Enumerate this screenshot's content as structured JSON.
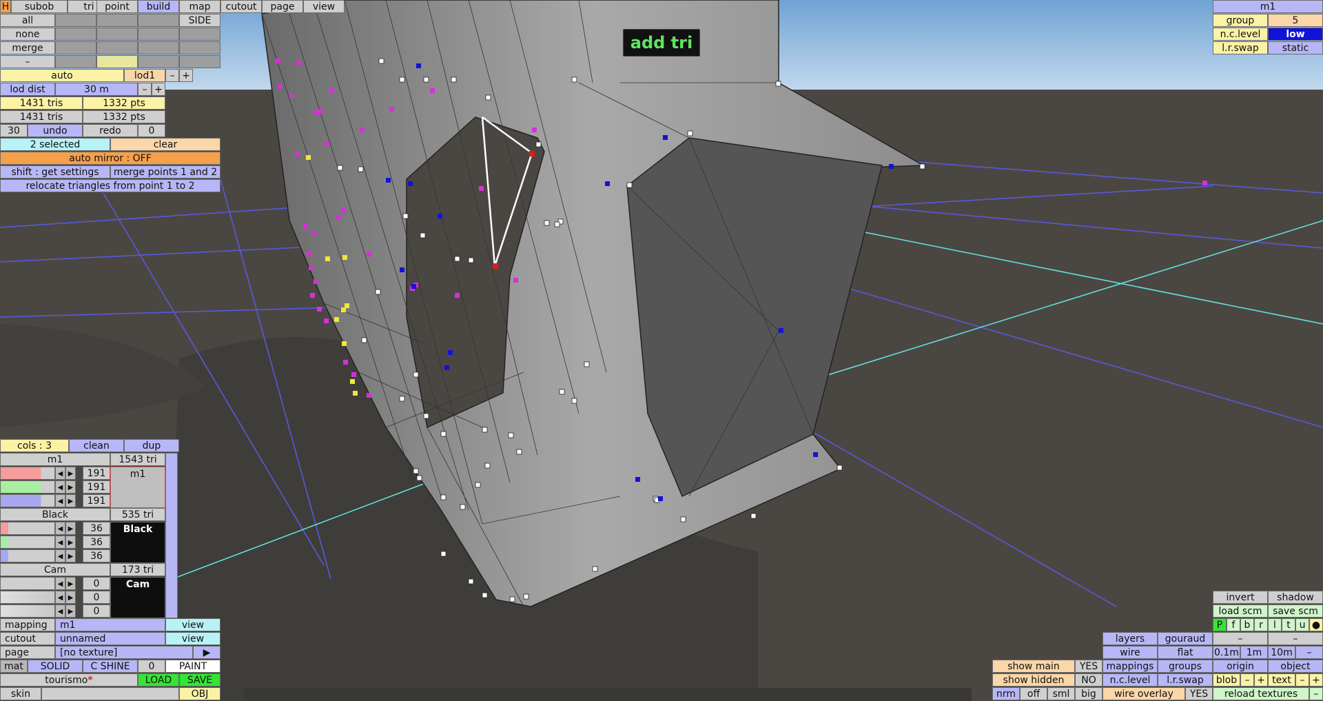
{
  "toolbar": {
    "h": "H",
    "tabs": [
      "subob",
      "tri",
      "point",
      "build",
      "map",
      "cutout",
      "page",
      "view"
    ],
    "active_tab": "build"
  },
  "select": {
    "all": "all",
    "none": "none",
    "merge": "merge",
    "minus": "–",
    "side": "SIDE"
  },
  "lod": {
    "auto": "auto",
    "name": "lod1",
    "minus": "–",
    "plus": "+",
    "dist_label": "lod dist",
    "dist_value": "30 m",
    "dist_minus": "–",
    "dist_plus": "+"
  },
  "stats": {
    "tris1": "1431 tris",
    "pts1": "1332 pts",
    "tris2": "1431 tris",
    "pts2": "1332 pts"
  },
  "history": {
    "left": "30",
    "undo": "undo",
    "redo": "redo",
    "right": "0"
  },
  "selection": {
    "count": "2 selected",
    "clear": "clear",
    "mirror": "auto mirror : OFF",
    "shift": "shift : get settings",
    "merge_points": "merge points 1 and 2",
    "relocate": "relocate triangles from point 1 to 2"
  },
  "hud": {
    "mode": "add tri"
  },
  "topright": {
    "name": "m1",
    "group_label": "group",
    "group_value": "5",
    "nclevel_label": "n.c.level",
    "nclevel_value": "low",
    "lrswap_label": "l.r.swap",
    "lrswap_value": "static"
  },
  "materials": {
    "cols": "cols : 3",
    "clean": "clean",
    "dup": "dup",
    "items": [
      {
        "name": "m1",
        "tri": "1543 tri",
        "r": "191",
        "g": "191",
        "b": "191",
        "swatch": "m1",
        "color": "#bfbfbf"
      },
      {
        "name": "Black",
        "tri": "535 tri",
        "r": "36",
        "g": "36",
        "b": "36",
        "swatch": "Black",
        "color": "#242424"
      },
      {
        "name": "Cam",
        "tri": "173 tri",
        "r": "0",
        "g": "0",
        "b": "0",
        "swatch": "Cam",
        "color": "#000000"
      }
    ]
  },
  "bottomleft": {
    "mapping_label": "mapping",
    "mapping_value": "m1",
    "mapping_view": "view",
    "cutout_label": "cutout",
    "cutout_value": "unnamed",
    "cutout_view": "view",
    "page_label": "page",
    "page_value": "[no texture]",
    "page_arrow": "▶",
    "mat": "mat",
    "solid": "SOLID",
    "cshine": "C SHINE",
    "zero": "0",
    "paint": "PAINT",
    "filename": "tourismo",
    "modified": "*",
    "load": "LOAD",
    "save": "SAVE",
    "skin": "skin",
    "obj": "OBJ"
  },
  "bottomright": {
    "show_main": "show main",
    "show_main_val": "YES",
    "show_hidden": "show hidden",
    "show_hidden_val": "NO",
    "nrm": "nrm",
    "off": "off",
    "sml": "sml",
    "big": "big",
    "layers": "layers",
    "gouraud": "gouraud",
    "wire": "wire",
    "flat": "flat",
    "mappings": "mappings",
    "groups": "groups",
    "nclevel": "n.c.level",
    "lrswap": "l.r.swap",
    "wire_overlay": "wire overlay",
    "wire_overlay_val": "YES",
    "invert": "invert",
    "shadow": "shadow",
    "load_scm": "load scm",
    "save_scm": "save scm",
    "letters": [
      "P",
      "f",
      "b",
      "r",
      "l",
      "t",
      "u"
    ],
    "dot": "●",
    "dash1": "–",
    "dash2": "–",
    "d01": "0.1m",
    "d1": "1m",
    "d10": "10m",
    "dminus": "–",
    "origin": "origin",
    "object": "object",
    "blob": "blob",
    "blob_minus": "–",
    "blob_plus": "+",
    "text": "text",
    "text_minus": "–",
    "text_plus": "+",
    "reload": "reload textures",
    "reload_minus": "–"
  },
  "colors": {
    "accent_blue": "#b7b7f7",
    "hud_green": "#5ee65e",
    "selected_edge": "#ffffff",
    "magenta_points": "#d630d6",
    "grid": "#5a5ae6",
    "grid_axis": "#63e6e6"
  }
}
